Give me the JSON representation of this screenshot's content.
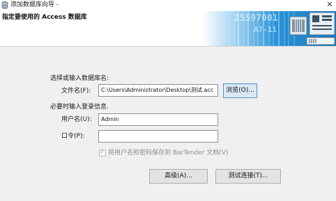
{
  "window": {
    "title": "添加数据库向导 -",
    "close_symbol": "✕"
  },
  "header": {
    "title": "指定要使用的 Access 数据库",
    "banner_text_1": "25597001",
    "banner_text_2": "A7-11"
  },
  "form": {
    "section_label": "选择或输入数据库名:",
    "file_label": "文件名(F):",
    "file_value": "C:\\Users\\Administrator\\Desktop\\测试.acc",
    "browse_label": "浏览(O)...",
    "login_label": "必要时输入登录信息.",
    "username_label": "用户名(U):",
    "username_value": "Admin",
    "password_label": "口令(P):",
    "password_value": "",
    "save_checkbox_label": "将用户名和密码保存到 BarTender 文档(V)",
    "save_checkbox_checked": true,
    "save_checkbox_enabled": false
  },
  "buttons": {
    "advanced_label": "高级(A)...",
    "test_label": "测试连接(T)..."
  },
  "colors": {
    "banner_blue": "#1f8fd6",
    "focus_border": "#4f8fd0"
  }
}
